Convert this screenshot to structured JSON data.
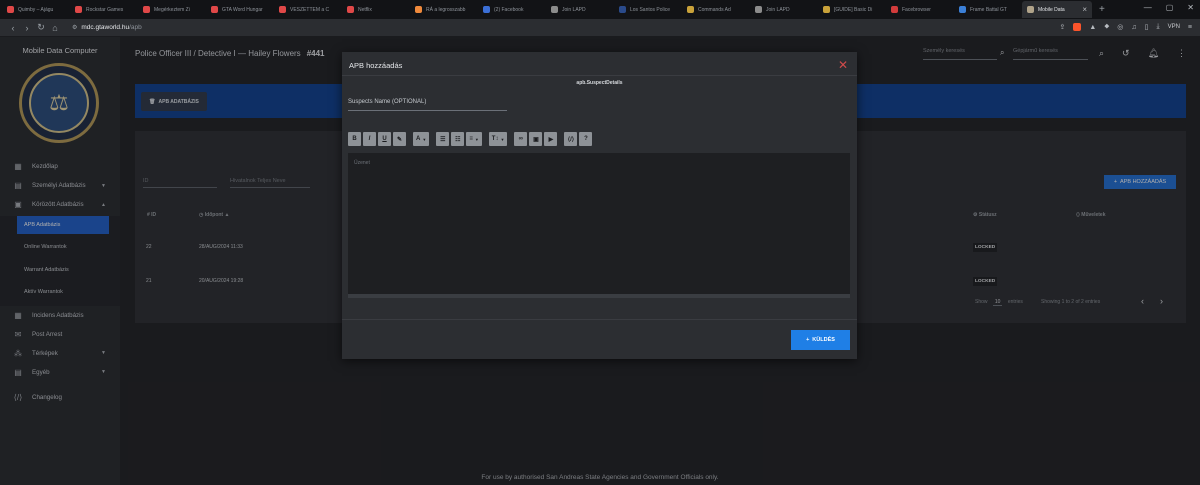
{
  "browser": {
    "tabs": [
      {
        "label": "Quimby – Ajágu",
        "color": "#e04848"
      },
      {
        "label": "Rockstar Games",
        "color": "#e04848"
      },
      {
        "label": "Megérkeztem Zi",
        "color": "#e04848"
      },
      {
        "label": "GTA Word Hungar",
        "color": "#e04848"
      },
      {
        "label": "VESZETTEM a C",
        "color": "#e04848"
      },
      {
        "label": "Netflix",
        "color": "#e04848"
      },
      {
        "label": "RÁ a legrosszabb",
        "color": "#f08a3c"
      },
      {
        "label": "(2) Facebook",
        "color": "#3b6fd6"
      },
      {
        "label": "Join LAPD",
        "color": "#8c8c8c"
      },
      {
        "label": "Los Santos Police",
        "color": "#2a4a8a"
      },
      {
        "label": "Commands Ad",
        "color": "#c9a23a"
      },
      {
        "label": "Join LAPD",
        "color": "#8c8c8c"
      },
      {
        "label": "[GUIDE] Basic Di",
        "color": "#c9a23a"
      },
      {
        "label": "Facebrowser",
        "color": "#d23b3b"
      },
      {
        "label": "Frame Battal GT",
        "color": "#3b7fd6"
      },
      {
        "label": "Mobile Data",
        "color": "#b0a38a"
      }
    ],
    "url_host": "mdc.gtaworld.hu",
    "url_path": "/apb",
    "vpn_label": "VPN"
  },
  "sidebar": {
    "title": "Mobile Data Computer",
    "items": [
      {
        "label": "Kezdőlap",
        "icon": "dashboard-icon",
        "glyph": "▦",
        "caret": ""
      },
      {
        "label": "Személyi Adatbázis",
        "icon": "id-card-icon",
        "glyph": "▤",
        "caret": "▼"
      },
      {
        "label": "Körözött Adatbázis",
        "icon": "wanted-icon",
        "glyph": "▣",
        "caret": "▲"
      }
    ],
    "subitems": [
      "APB Adatbázis",
      "Online Warrantok",
      "Warrant Adatbázis",
      "Aktív Warrantok"
    ],
    "items2": [
      {
        "label": "Incidens Adatbázis",
        "icon": "table-icon",
        "glyph": "▦",
        "caret": ""
      },
      {
        "label": "Post Arrest",
        "icon": "mail-icon",
        "glyph": "✉",
        "caret": ""
      },
      {
        "label": "Térképek",
        "icon": "map-icon",
        "glyph": "⁂",
        "caret": "▼"
      },
      {
        "label": "Egyéb",
        "icon": "box-icon",
        "glyph": "▤",
        "caret": "▼"
      }
    ],
    "changelog": "Changelog"
  },
  "header": {
    "officer": "Police Officer III / Detective I — Hailey Flowers",
    "badge": "#441",
    "person_search_ph": "Személy keresés",
    "vehicle_search_ph": "Gépjármű keresés"
  },
  "content": {
    "apb_db_button": "APB ADATBÁZIS",
    "id_filter": "ID",
    "officer_filter": "Hivatalnok Teljes Neve",
    "add_button": "APB HOZZÁADÁS",
    "columns": {
      "id": "ID",
      "time": "Időpont",
      "status": "Státusz",
      "actions": "Műveletek"
    },
    "rows": [
      {
        "id": "22",
        "time": "28/AUG/2024 11:33",
        "status": "LOCKED"
      },
      {
        "id": "21",
        "time": "20/AUG/2024 19:28",
        "status": "LOCKED"
      }
    ],
    "show_label": "Show",
    "show_value": "10",
    "entries_label": "entries",
    "showing": "Showing 1 to 2 of 2 entries",
    "prev": "‹",
    "next": "›"
  },
  "modal": {
    "title": "APB hozzáadás",
    "field_key": "apb.SuspectDetails",
    "suspect_placeholder": "Suspects Name (OPTIONAL)",
    "editor_placeholder": "Üzenet",
    "send_label": "KÜLDÉS"
  },
  "footer": "For use by authorised San Andreas State Agencies and Government Officials only."
}
